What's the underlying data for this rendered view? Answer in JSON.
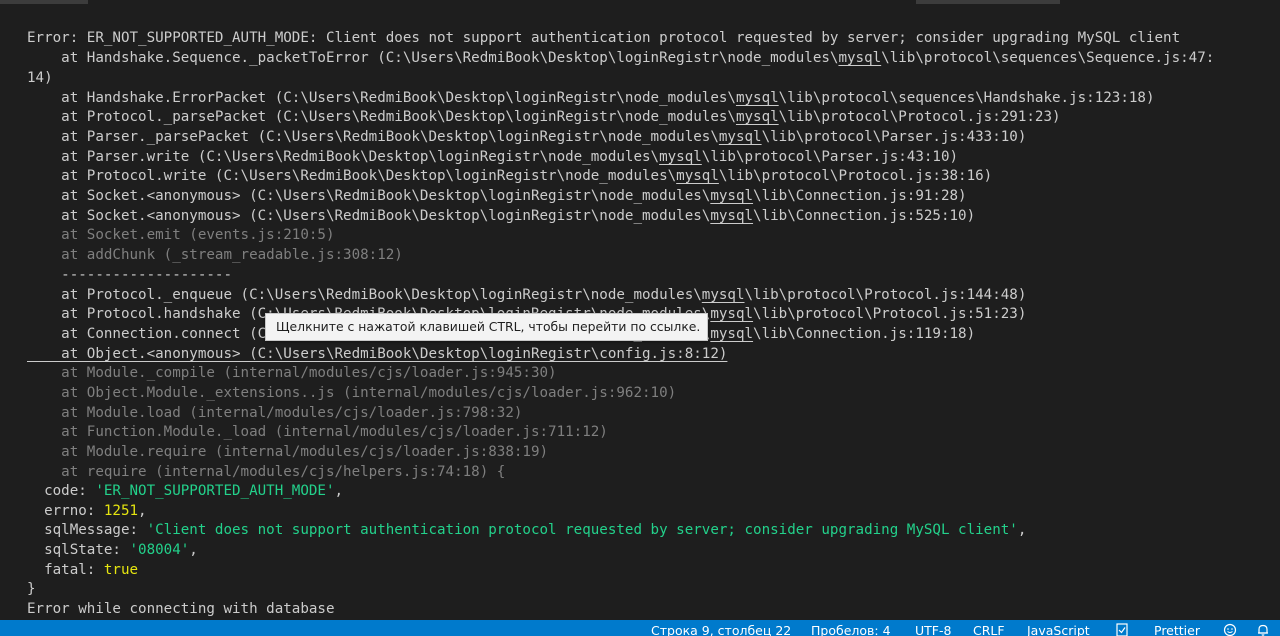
{
  "terminal": {
    "lines": [
      "Error: ER_NOT_SUPPORTED_AUTH_MODE: Client does not support authentication protocol requested by server; consider upgrading MySQL client",
      "    at Handshake.Sequence._packetToError (C:\\Users\\RedmiBook\\Desktop\\loginRegistr\\node_modules\\mysql\\lib\\protocol\\sequences\\Sequence.js:47:",
      "14)",
      "    at Handshake.ErrorPacket (C:\\Users\\RedmiBook\\Desktop\\loginRegistr\\node_modules\\mysql\\lib\\protocol\\sequences\\Handshake.js:123:18)",
      "    at Protocol._parsePacket (C:\\Users\\RedmiBook\\Desktop\\loginRegistr\\node_modules\\mysql\\lib\\protocol\\Protocol.js:291:23)",
      "    at Parser._parsePacket (C:\\Users\\RedmiBook\\Desktop\\loginRegistr\\node_modules\\mysql\\lib\\protocol\\Parser.js:433:10)",
      "    at Parser.write (C:\\Users\\RedmiBook\\Desktop\\loginRegistr\\node_modules\\mysql\\lib\\protocol\\Parser.js:43:10)",
      "    at Protocol.write (C:\\Users\\RedmiBook\\Desktop\\loginRegistr\\node_modules\\mysql\\lib\\protocol\\Protocol.js:38:16)",
      "    at Socket.<anonymous> (C:\\Users\\RedmiBook\\Desktop\\loginRegistr\\node_modules\\mysql\\lib\\Connection.js:91:28)",
      "    at Socket.<anonymous> (C:\\Users\\RedmiBook\\Desktop\\loginRegistr\\node_modules\\mysql\\lib\\Connection.js:525:10)",
      "    at Socket.emit (events.js:210:5)",
      "    at addChunk (_stream_readable.js:308:12)",
      "    --------------------",
      "    at Protocol._enqueue (C:\\Users\\RedmiBook\\Desktop\\loginRegistr\\node_modules\\mysql\\lib\\protocol\\Protocol.js:144:48)",
      "    at Protocol.handshake (C:\\Users\\RedmiBook\\Desktop\\loginRegistr\\node_modules\\mysql\\lib\\protocol\\Protocol.js:51:23)",
      "    at Connection.connect (C:\\Users\\RedmiBook\\Desktop\\loginRegistr\\node_modules\\mysql\\lib\\Connection.js:119:18)",
      "    at Object.<anonymous> (C:\\Users\\RedmiBook\\Desktop\\loginRegistr\\config.js:8:12)",
      "    at Module._compile (internal/modules/cjs/loader.js:945:30)",
      "    at Object.Module._extensions..js (internal/modules/cjs/loader.js:962:10)",
      "    at Module.load (internal/modules/cjs/loader.js:798:32)",
      "    at Function.Module._load (internal/modules/cjs/loader.js:711:12)",
      "    at Module.require (internal/modules/cjs/loader.js:838:19)",
      "    at require (internal/modules/cjs/helpers.js:74:18) {",
      "  code: 'ER_NOT_SUPPORTED_AUTH_MODE',",
      "  errno: 1251,",
      "  sqlMessage: 'Client does not support authentication protocol requested by server; consider upgrading MySQL client',",
      "  sqlState: '08004',",
      "  fatal: true",
      "}",
      "Error while connecting with database"
    ],
    "overflow_char": "1",
    "tooltip": "Щелкните с нажатой клавишей CTRL, чтобы перейти по ссылке."
  },
  "statusbar": {
    "position": "Строка 9, столбец 22",
    "spaces": "Пробелов: 4",
    "encoding": "UTF-8",
    "eol": "CRLF",
    "language": "JavaScript",
    "formatter": "Prettier",
    "icons": {
      "formatter": "formatter-icon",
      "feedback": "feedback-icon",
      "notifications": "bell-icon"
    }
  },
  "colors": {
    "background": "#1e1e1e",
    "foreground": "#cccccc",
    "dim": "#7f7f7f",
    "string": "#23d18b",
    "number": "#e5e510",
    "statusbar": "#007acc"
  }
}
